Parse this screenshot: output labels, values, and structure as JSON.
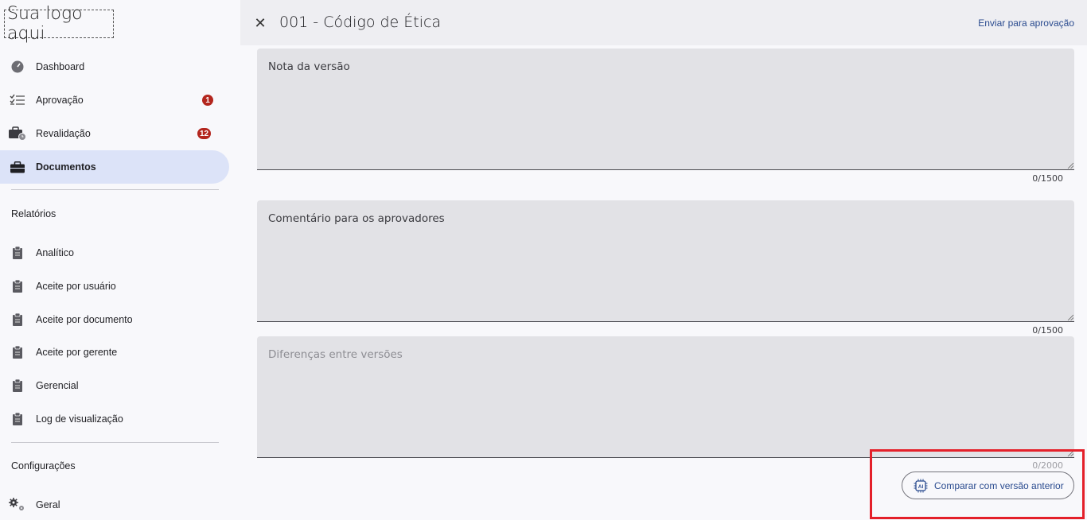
{
  "logo": {
    "text": "Sua logo aqui"
  },
  "sidebar": {
    "items": [
      {
        "label": "Dashboard",
        "icon": "dashboard-gauge-icon"
      },
      {
        "label": "Aprovação",
        "icon": "checklist-icon",
        "badge": "1"
      },
      {
        "label": "Revalidação",
        "icon": "briefcase-clock-icon",
        "badge": "12"
      },
      {
        "label": "Documentos",
        "icon": "briefcase-icon",
        "active": true
      }
    ],
    "reports_title": "Relatórios",
    "reports": [
      {
        "label": "Analítico",
        "icon": "clipboard-icon"
      },
      {
        "label": "Aceite por usuário",
        "icon": "clipboard-icon"
      },
      {
        "label": "Aceite por documento",
        "icon": "clipboard-icon"
      },
      {
        "label": "Aceite por gerente",
        "icon": "clipboard-icon"
      },
      {
        "label": "Gerencial",
        "icon": "clipboard-icon"
      },
      {
        "label": "Log de visualização",
        "icon": "clipboard-icon"
      }
    ],
    "settings_title": "Configurações",
    "settings": [
      {
        "label": "Geral",
        "icon": "gears-icon"
      }
    ]
  },
  "header": {
    "title": "001 - Código de Ética",
    "send_label": "Enviar para aprovação"
  },
  "form": {
    "version_note": {
      "placeholder": "Nota da versão",
      "counter": "0/1500"
    },
    "approver_comment": {
      "placeholder": "Comentário para os aprovadores",
      "counter": "0/1500"
    },
    "differences": {
      "placeholder": "Diferenças entre versões",
      "counter": "0/2000"
    },
    "compare_label": "Comparar com versão anterior"
  },
  "colors": {
    "accent": "#2a4b8f",
    "active_nav": "#dce3f8",
    "badge": "#b3261e",
    "highlight": "#e4202a"
  }
}
